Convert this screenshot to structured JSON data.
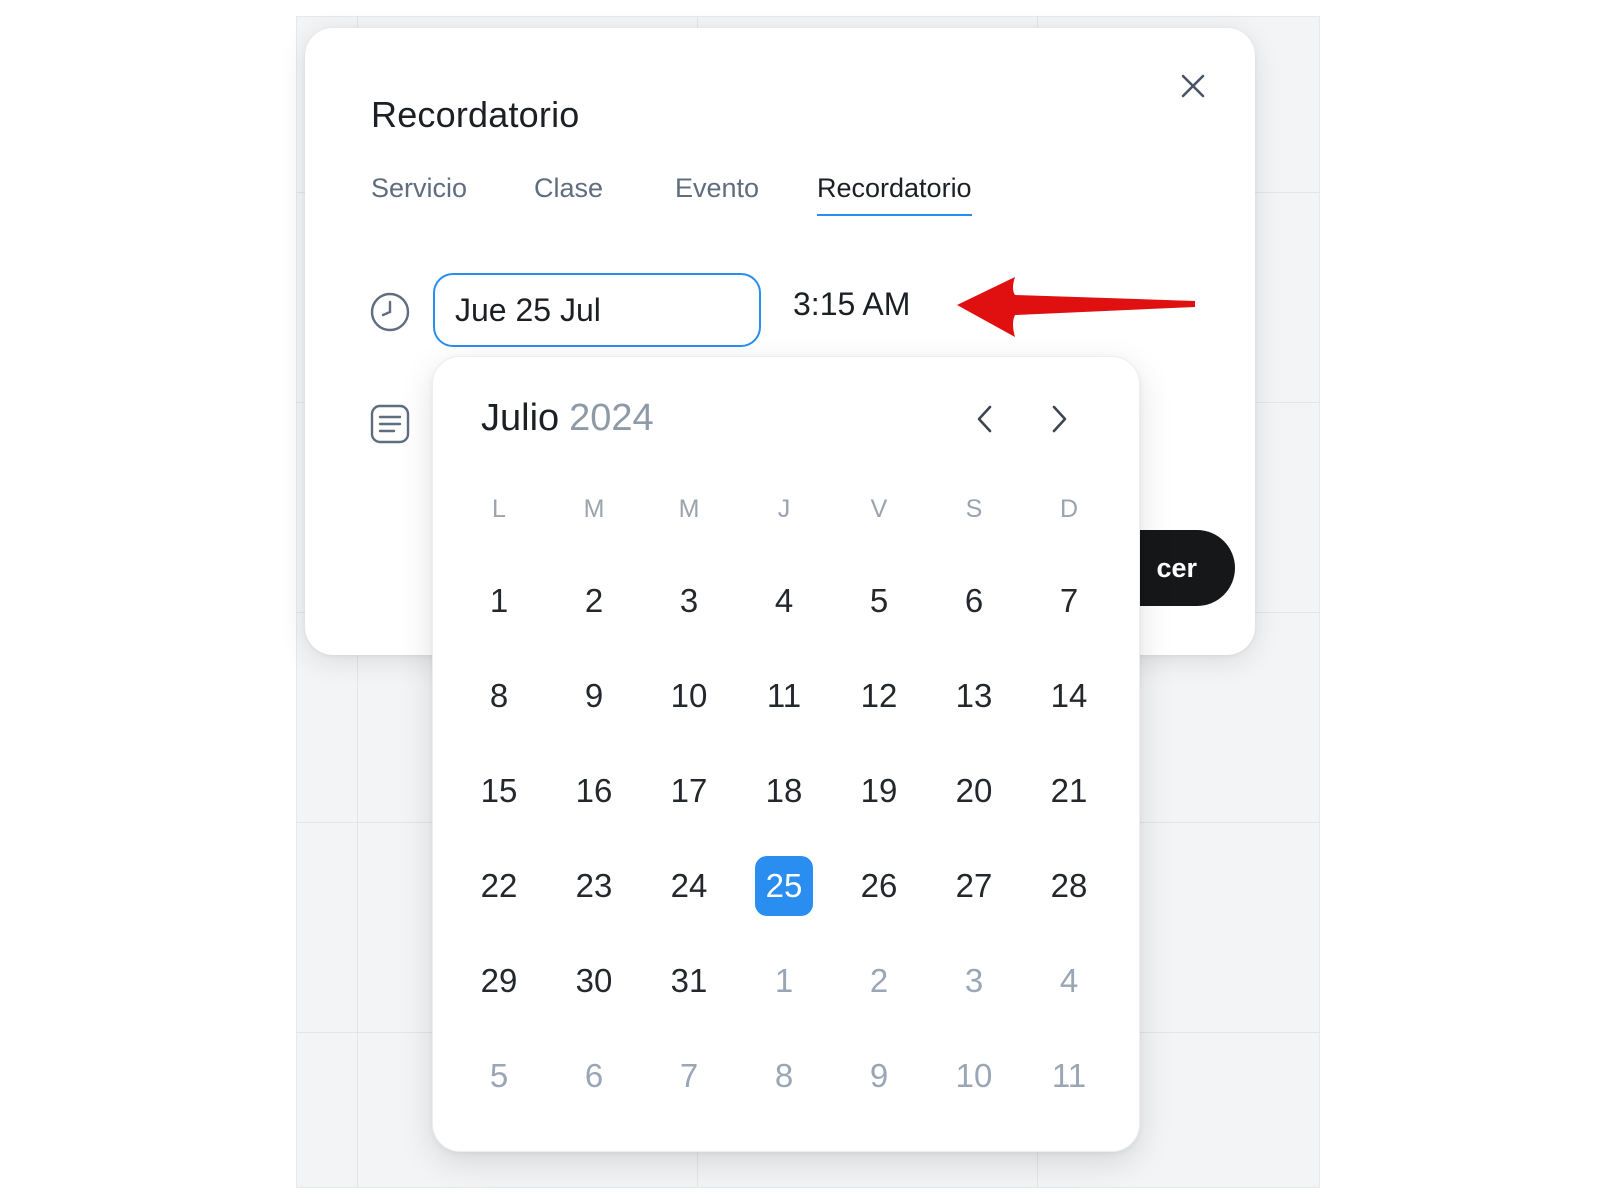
{
  "modal": {
    "title": "Recordatorio",
    "close_icon": "close-icon",
    "tabs": [
      {
        "label": "Servicio",
        "active": false
      },
      {
        "label": "Clase",
        "active": false
      },
      {
        "label": "Evento",
        "active": false
      },
      {
        "label": "Recordatorio",
        "active": true
      }
    ],
    "date_value": "Jue 25 Jul",
    "time_value": "3:15 AM",
    "clock_icon": "clock-icon",
    "note_icon": "note-icon",
    "confirm_label_visible": "cer"
  },
  "annotation": {
    "arrow_color": "#e01010"
  },
  "calendar": {
    "month": "Julio",
    "year": "2024",
    "prev_icon": "chevron-left-icon",
    "next_icon": "chevron-right-icon",
    "weekdays": [
      "L",
      "M",
      "M",
      "J",
      "V",
      "S",
      "D"
    ],
    "selected_day": "25",
    "accent_color": "#2a8df0",
    "weeks": [
      [
        {
          "d": "1"
        },
        {
          "d": "2"
        },
        {
          "d": "3"
        },
        {
          "d": "4"
        },
        {
          "d": "5"
        },
        {
          "d": "6"
        },
        {
          "d": "7"
        }
      ],
      [
        {
          "d": "8"
        },
        {
          "d": "9"
        },
        {
          "d": "10"
        },
        {
          "d": "11"
        },
        {
          "d": "12"
        },
        {
          "d": "13"
        },
        {
          "d": "14"
        }
      ],
      [
        {
          "d": "15"
        },
        {
          "d": "16"
        },
        {
          "d": "17"
        },
        {
          "d": "18"
        },
        {
          "d": "19"
        },
        {
          "d": "20"
        },
        {
          "d": "21"
        }
      ],
      [
        {
          "d": "22"
        },
        {
          "d": "23"
        },
        {
          "d": "24"
        },
        {
          "d": "25",
          "selected": true
        },
        {
          "d": "26"
        },
        {
          "d": "27"
        },
        {
          "d": "28"
        }
      ],
      [
        {
          "d": "29"
        },
        {
          "d": "30"
        },
        {
          "d": "31"
        },
        {
          "d": "1",
          "muted": true
        },
        {
          "d": "2",
          "muted": true
        },
        {
          "d": "3",
          "muted": true
        },
        {
          "d": "4",
          "muted": true
        }
      ],
      [
        {
          "d": "5",
          "muted": true
        },
        {
          "d": "6",
          "muted": true
        },
        {
          "d": "7",
          "muted": true
        },
        {
          "d": "8",
          "muted": true
        },
        {
          "d": "9",
          "muted": true
        },
        {
          "d": "10",
          "muted": true
        },
        {
          "d": "11",
          "muted": true
        }
      ]
    ]
  }
}
